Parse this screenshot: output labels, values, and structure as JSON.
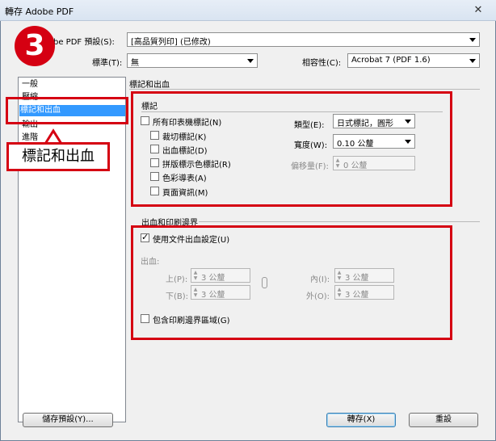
{
  "window": {
    "title": "轉存 Adobe PDF",
    "close_glyph": "✕"
  },
  "top": {
    "preset_label": "be PDF 預設(S):",
    "preset_value": "[高品質列印] (已修改)",
    "standard_label": "標準(T):",
    "standard_value": "無",
    "compat_label": "相容性(C):",
    "compat_value": "Acrobat 7 (PDF 1.6)"
  },
  "sidebar": {
    "items": [
      {
        "label": "一般",
        "selected": false
      },
      {
        "label": "壓縮",
        "selected": false
      },
      {
        "label": "標記和出血",
        "selected": true
      },
      {
        "label": "輸出",
        "selected": false
      },
      {
        "label": "進階",
        "selected": false
      }
    ]
  },
  "section_title": "標記和出血",
  "marks": {
    "group_title": "標記",
    "all_marks": {
      "label": "所有印表機標記(N)",
      "checked": false
    },
    "items": [
      {
        "label": "裁切標記(K)",
        "checked": false
      },
      {
        "label": "出血標記(D)",
        "checked": false
      },
      {
        "label": "拼版標示色標記(R)",
        "checked": false
      },
      {
        "label": "色彩導表(A)",
        "checked": false
      },
      {
        "label": "頁面資訊(M)",
        "checked": false
      }
    ],
    "type_label": "類型(E):",
    "type_value": "日式標記，圓形",
    "weight_label": "寬度(W):",
    "weight_value": "0.10 公釐",
    "offset_label": "偏移量(F):",
    "offset_value": "0 公釐"
  },
  "bleed": {
    "group_title": "出血和印刷邊界",
    "use_doc": {
      "label": "使用文件出血設定(U)",
      "checked": true
    },
    "bleed_label": "出血:",
    "top_label": "上(P):",
    "top_value": "3 公釐",
    "bottom_label": "下(B):",
    "bottom_value": "3 公釐",
    "inside_label": "內(I):",
    "inside_value": "3 公釐",
    "outside_label": "外(O):",
    "outside_value": "3 公釐",
    "slug": {
      "label": "包含印刷邊界區域(G)",
      "checked": false
    }
  },
  "buttons": {
    "save_preset": "儲存預設(Y)...",
    "export": "轉存(X)",
    "reset": "重設"
  },
  "annotations": {
    "step_number": "3",
    "callout_text": "標記和出血",
    "accent_color": "#d50012"
  }
}
